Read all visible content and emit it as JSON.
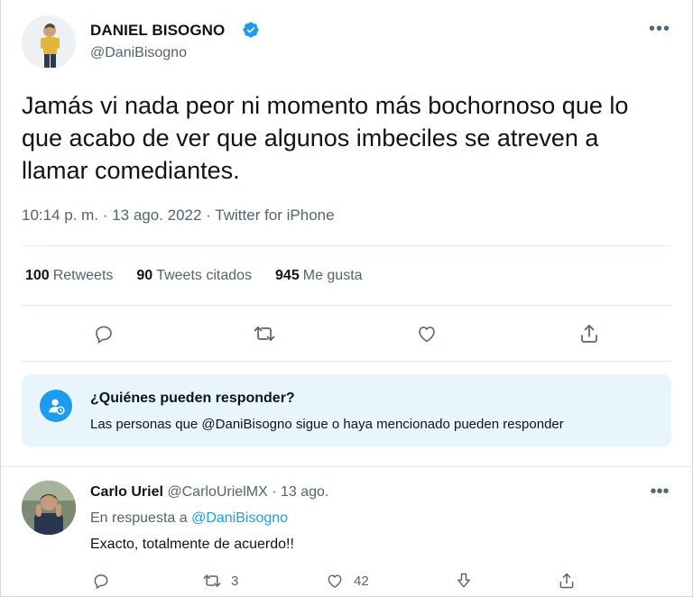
{
  "tweet": {
    "author_name": "DANIEL BISOGNO",
    "author_handle": "@DaniBisogno",
    "verified_icon": "verified-badge-icon",
    "more_icon": "more-horizontal-icon",
    "more_glyph": "•••",
    "text": "Jamás vi nada peor ni momento más bochornoso que lo que acabo de ver que algunos imbeciles se atreven a llamar comediantes.",
    "time": "10:14 p. m.",
    "sep": "·",
    "date": "13 ago. 2022",
    "source": "Twitter for iPhone",
    "stats": [
      {
        "count": "100",
        "label": "Retweets"
      },
      {
        "count": "90",
        "label": "Tweets citados"
      },
      {
        "count": "945",
        "label": "Me gusta"
      }
    ],
    "actions": [
      "reply-icon",
      "retweet-icon",
      "like-icon",
      "share-icon"
    ]
  },
  "reply_notice": {
    "title": "¿Quiénes pueden responder?",
    "text": "Las personas que @DaniBisogno sigue o haya mencionado pueden responder",
    "icon": "mention-user-icon"
  },
  "reply": {
    "author_name": "Carlo Uriel",
    "author_handle": "@CarloUrielMX",
    "dot": "·",
    "time": "13 ago.",
    "replying_prefix": "En respuesta a",
    "replying_to": "@DaniBisogno",
    "text": "Exacto, totalmente de acuerdo!!",
    "more_glyph": "•••",
    "actions": {
      "reply_count": "",
      "retweet_count": "3",
      "like_count": "42"
    }
  },
  "colors": {
    "accent": "#1d9bf0",
    "text": "#0f1419",
    "secondary": "#536471",
    "notice_bg": "#e8f5fd",
    "divider": "#e1e8ed"
  }
}
